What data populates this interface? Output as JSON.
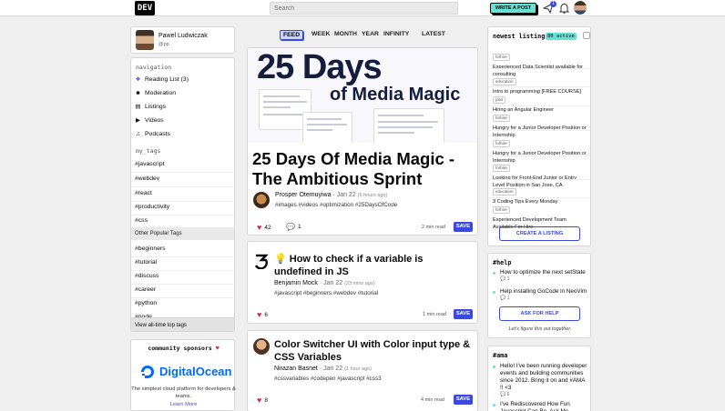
{
  "nav": {
    "logo": "DEV",
    "search_placeholder": "Search",
    "write_post": "WRITE A POST",
    "notification_count": "1"
  },
  "profile": {
    "name": "Pawel Ludwiczak",
    "handle": "@pp"
  },
  "sidebar": {
    "nav_title": "navigation",
    "items": [
      {
        "label": "Reading List (3)",
        "icon": "bookmark-icon"
      },
      {
        "label": "Moderation",
        "icon": "moderation-icon"
      },
      {
        "label": "Listings",
        "icon": "listings-icon"
      },
      {
        "label": "Videos",
        "icon": "video-icon"
      },
      {
        "label": "Podcasts",
        "icon": "headphones-icon"
      }
    ],
    "my_tags_title": "my_tags",
    "my_tags": [
      "#javascript",
      "#webdev",
      "#react",
      "#productivity",
      "#css"
    ],
    "other_popular_title": "Other Popular Tags",
    "popular_tags": [
      "#beginners",
      "#tutorial",
      "#discuss",
      "#career",
      "#python",
      "#node"
    ],
    "view_all": "View all-time top tags"
  },
  "sponsors": {
    "title": "community sponsors",
    "name": "DigitalOcean",
    "desc": "The simplest cloud platform for developers & teams.",
    "learn_more": "Learn More"
  },
  "feed_tabs": [
    "FEED",
    "WEEK",
    "MONTH",
    "YEAR",
    "INFINITY",
    "LATEST"
  ],
  "articles": [
    {
      "cover_line1": "25 Days",
      "cover_line2": "of Media Magic",
      "title": "25 Days Of Media Magic - The Ambitious Sprint",
      "author": "Prosper Otemuyiwa",
      "date": "Jan 22",
      "ago": "(5 hours ago)",
      "tags": "#images #videos #optimization #25DaysOfCode",
      "reactions": "42",
      "comments": "1",
      "read_time": "2 min read",
      "save": "SAVE"
    },
    {
      "title": "💡 How to check if a variable is undefined in JS",
      "author": "Benjamin Mock",
      "date": "Jan 22",
      "ago": "(23 mins ago)",
      "tags": "#javascript #beginners #webdev #tutorial",
      "reactions": "6",
      "read_time": "1 min read",
      "save": "SAVE"
    },
    {
      "title": "Color Switcher UI with Color input type & CSS Variables",
      "author": "Nirazan Basnet",
      "date": "Jan 22",
      "ago": "(1 hour ago)",
      "tags": "#cssvariables #codepen #javascript #css3",
      "reactions": "8",
      "read_time": "4 min read",
      "save": "SAVE"
    }
  ],
  "listings": {
    "title": "newest listings",
    "badge": "80 active",
    "items": [
      {
        "cat": "forhire",
        "title": "Experienced Data Scientist available for consulting"
      },
      {
        "cat": "education",
        "title": "Intro to programming [FREE COURSE]"
      },
      {
        "cat": "jobs",
        "title": "Hiring an Angular Engineer"
      },
      {
        "cat": "forhire",
        "title": "Hungry for a Junior Developer Position or Internship"
      },
      {
        "cat": "forhire",
        "title": "Hungry for a Junior Developer Position or Internship"
      },
      {
        "cat": "forhire",
        "title": "Looking for Front-End Junior or Entry Level Position in San Jose, CA"
      },
      {
        "cat": "education",
        "title": "3 Coding Tips Every Monday"
      },
      {
        "cat": "forhire",
        "title": "Experienced Development Team Available For Hire"
      }
    ],
    "create": "CREATE A LISTING"
  },
  "help": {
    "title": "#help",
    "items": [
      {
        "title": "How to optimize the next setState",
        "comments": "1"
      },
      {
        "title": "Help installing GoCode in NeoVim",
        "comments": "1"
      }
    ],
    "ask": "ASK FOR HELP",
    "note": "Let's figure this out together."
  },
  "ama": {
    "title": "#ama",
    "items": [
      {
        "title": "Hello! I've been running developer events and building communities since 2012. Bring it on and #AMA !! <3",
        "comments": "6"
      },
      {
        "title": "I've Rediscovered How Fun Javascript Can Be. Ask Me Anything!"
      }
    ]
  },
  "colors": {
    "accent": "#3b49df",
    "mint": "#66e2d5",
    "background": "#efefef"
  }
}
